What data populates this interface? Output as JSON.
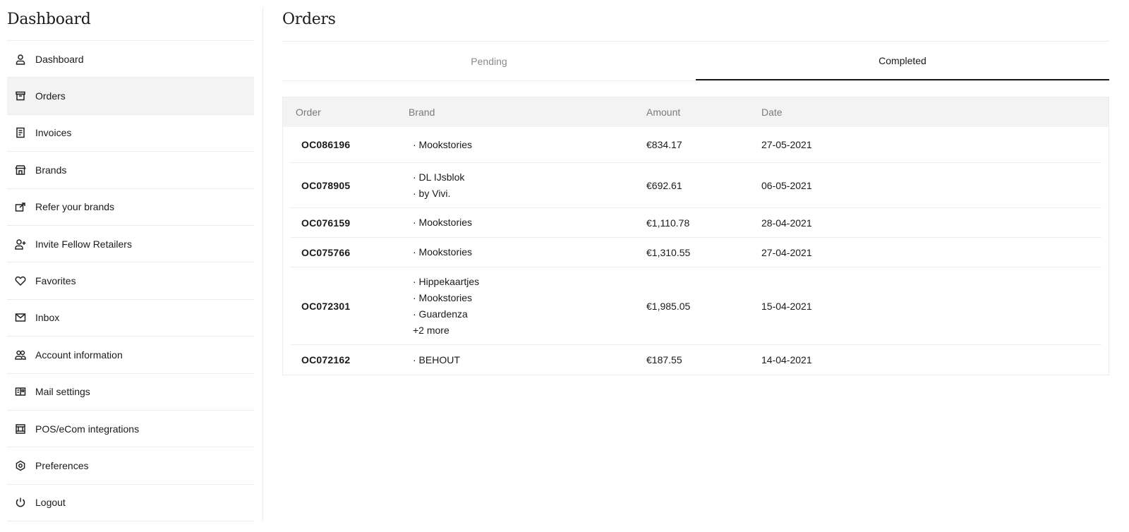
{
  "sidebar": {
    "title": "Dashboard",
    "items": [
      {
        "label": "Dashboard",
        "icon": "user-icon"
      },
      {
        "label": "Orders",
        "icon": "box-icon"
      },
      {
        "label": "Invoices",
        "icon": "document-icon"
      },
      {
        "label": "Brands",
        "icon": "store-icon"
      },
      {
        "label": "Refer your brands",
        "icon": "share-icon"
      },
      {
        "label": "Invite Fellow Retailers",
        "icon": "user-plus-icon"
      },
      {
        "label": "Favorites",
        "icon": "heart-icon"
      },
      {
        "label": "Inbox",
        "icon": "mail-icon"
      },
      {
        "label": "Account information",
        "icon": "users-icon"
      },
      {
        "label": "Mail settings",
        "icon": "mail-settings-icon"
      },
      {
        "label": "POS/eCom integrations",
        "icon": "integrations-icon"
      },
      {
        "label": "Preferences",
        "icon": "gear-icon"
      },
      {
        "label": "Logout",
        "icon": "power-icon"
      }
    ]
  },
  "main": {
    "title": "Orders",
    "tabs": [
      {
        "label": "Pending"
      },
      {
        "label": "Completed"
      }
    ],
    "table": {
      "headers": {
        "order": "Order",
        "brand": "Brand",
        "amount": "Amount",
        "date": "Date"
      },
      "rows": [
        {
          "order": "OC086196",
          "brands": [
            "· Mookstories"
          ],
          "more": "",
          "amount": "€834.17",
          "date": "27-05-2021"
        },
        {
          "order": "OC078905",
          "brands": [
            "· DL IJsblok",
            "· by Vivi."
          ],
          "more": "",
          "amount": "€692.61",
          "date": "06-05-2021"
        },
        {
          "order": "OC076159",
          "brands": [
            "· Mookstories"
          ],
          "more": "",
          "amount": "€1,110.78",
          "date": "28-04-2021"
        },
        {
          "order": "OC075766",
          "brands": [
            "· Mookstories"
          ],
          "more": "",
          "amount": "€1,310.55",
          "date": "27-04-2021"
        },
        {
          "order": "OC072301",
          "brands": [
            "· Hippekaartjes",
            "· Mookstories",
            "· Guardenza"
          ],
          "more": "+2 more",
          "amount": "€1,985.05",
          "date": "15-04-2021"
        },
        {
          "order": "OC072162",
          "brands": [
            "· BEHOUT"
          ],
          "more": "",
          "amount": "€187.55",
          "date": "14-04-2021"
        }
      ]
    }
  }
}
